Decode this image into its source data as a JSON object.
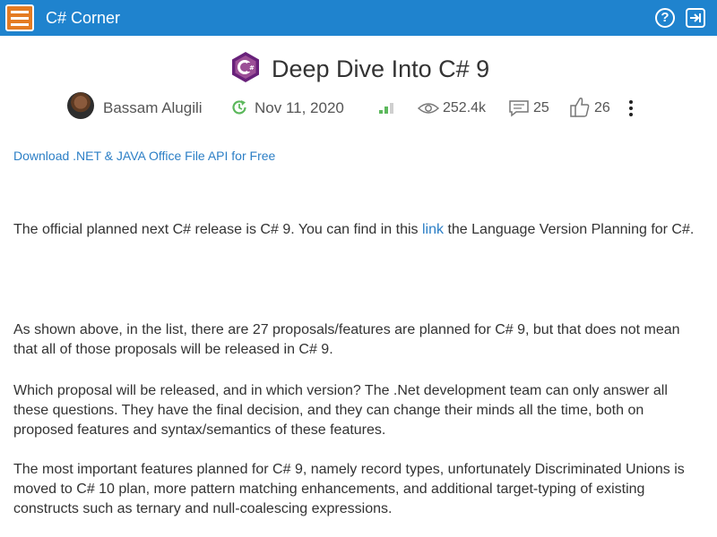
{
  "header": {
    "brand": "C# Corner",
    "help_glyph": "?"
  },
  "article": {
    "title": "Deep Dive Into C# 9",
    "author": "Bassam Alugili",
    "date": "Nov 11, 2020",
    "views": "252.4k",
    "comments": "25",
    "likes": "26"
  },
  "promo_link": "Download .NET & JAVA Office File API for Free",
  "paragraphs": {
    "p1_before": "The official planned next C# release is C# 9. You can find in this ",
    "p1_link": "link",
    "p1_after": " the Language Version Planning for C#.",
    "p2": "As shown above, in the list, there are 27 proposals/features are planned for C# 9, but that does not mean that all of those proposals will be released in C# 9.",
    "p3": "Which proposal will be released, and in which version? The .Net development team can only answer all these questions. They have the final decision, and they can change their minds all the time, both on proposed features and syntax/semantics of these features.",
    "p4": "The most important features planned for C# 9, namely record types, unfortunately Discriminated Unions is moved to C# 10 plan, more pattern matching enhancements, and additional target-typing of existing constructs such as ternary and null-coalescing expressions."
  },
  "icons": {
    "menu": "hamburger-menu-icon",
    "help": "help-circle-icon",
    "login": "login-icon",
    "logo": "csharp-logo-icon",
    "date": "clock-refresh-icon",
    "level": "signal-level-icon",
    "views": "eye-icon",
    "comments": "comment-icon",
    "likes": "thumbs-up-icon",
    "more": "more-vertical-icon"
  },
  "colors": {
    "header_bg": "#1f83ce",
    "menu_bg": "#e47b22",
    "link": "#2c7fc6",
    "logo_purple": "#68217a",
    "date_green": "#5cb85c"
  }
}
